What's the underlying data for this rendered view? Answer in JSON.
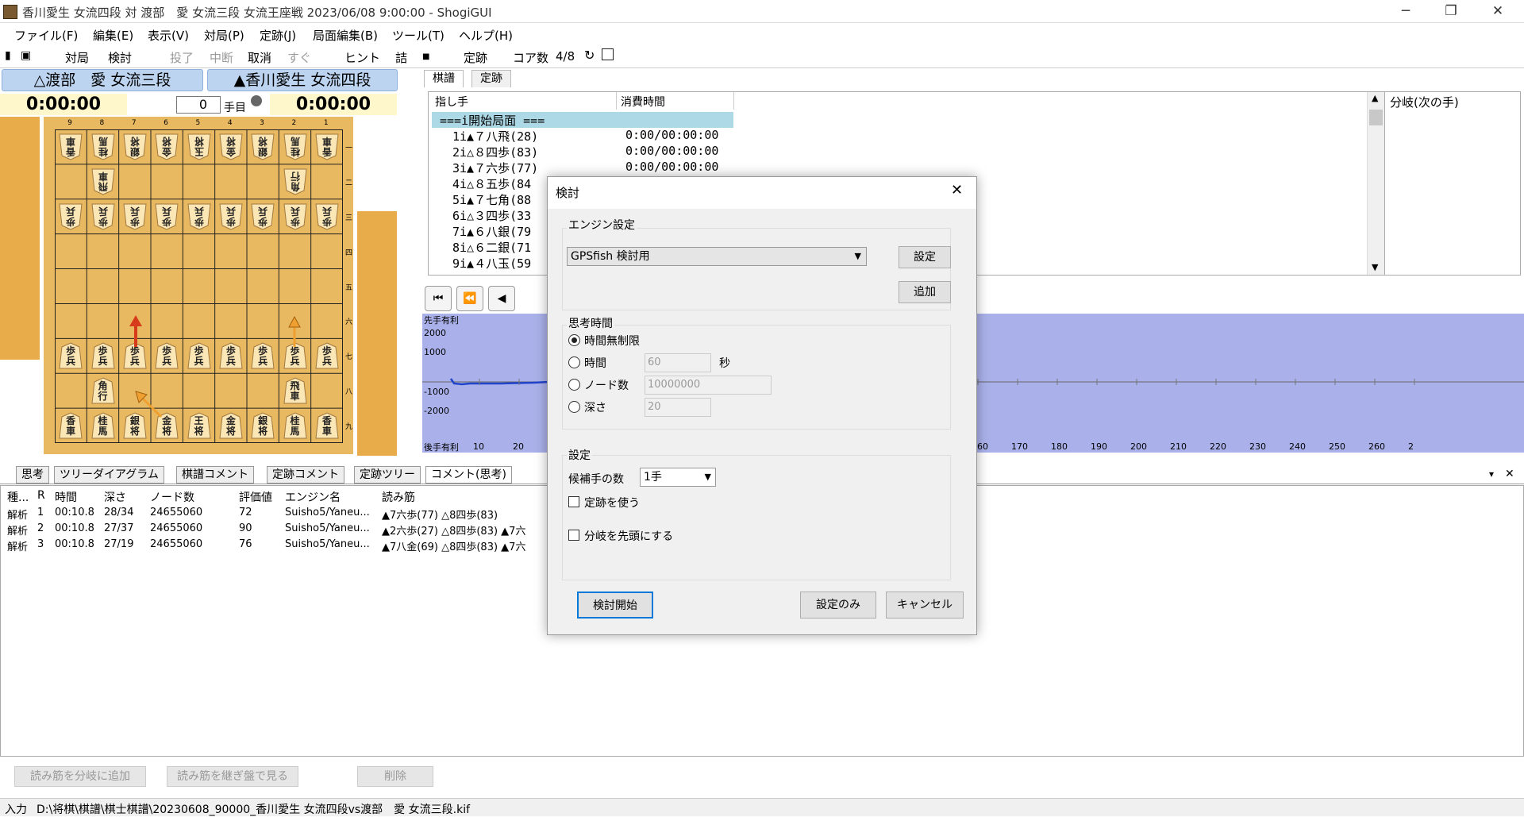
{
  "window": {
    "title": "香川愛生 女流四段 対 渡部　愛 女流三段 女流王座戦 2023/06/08 9:00:00 - ShogiGUI",
    "min": "─",
    "max": "❐",
    "close": "✕"
  },
  "menu": [
    "ファイル(F)",
    "編集(E)",
    "表示(V)",
    "対局(P)",
    "定跡(J)",
    "局面編集(B)",
    "ツール(T)",
    "ヘルプ(H)"
  ],
  "toolbar": {
    "taikyoku": "対局",
    "kentou": "検討",
    "touryou": "投了",
    "chudan": "中断",
    "torikeshi": "取消",
    "sugu": "すぐ",
    "hint": "ヒント",
    "tsume": "詰",
    "joseki": "定跡",
    "core_label": "コア数",
    "core_value": "4/8"
  },
  "players": {
    "gote": "△渡部　愛 女流三段",
    "sente": "▲香川愛生 女流四段",
    "gote_time": "0:00:00",
    "sente_time": "0:00:00",
    "move_no": "0",
    "move_suffix": "手目"
  },
  "board": {
    "files": [
      "9",
      "8",
      "7",
      "6",
      "5",
      "4",
      "3",
      "2",
      "1"
    ],
    "ranks": [
      "一",
      "二",
      "三",
      "四",
      "五",
      "六",
      "七",
      "八",
      "九"
    ],
    "row1": [
      "香\n車",
      "桂\n馬",
      "銀\n将",
      "金\n将",
      "玉\n将",
      "金\n将",
      "銀\n将",
      "桂\n馬",
      "香\n車"
    ],
    "row2": [
      "飛\n車",
      "角\n行"
    ],
    "pawn": "歩\n兵",
    "row8": [
      "角\n行",
      "飛\n車"
    ],
    "row9": [
      "香\n車",
      "桂\n馬",
      "銀\n将",
      "金\n将",
      "王\n将",
      "金\n将",
      "銀\n将",
      "桂\n馬",
      "香\n車"
    ]
  },
  "kifu": {
    "tabs": [
      "棋譜",
      "定跡"
    ],
    "col_move": "指し手",
    "col_time": "消費時間",
    "start": "===i開始局面 ===",
    "rows": [
      {
        "n": "1i",
        "m": "▲７八飛(28)",
        "t": "0:00/00:00:00"
      },
      {
        "n": "2i",
        "m": "△８四歩(83)",
        "t": "0:00/00:00:00"
      },
      {
        "n": "3i",
        "m": "▲７六歩(77)",
        "t": "0:00/00:00:00"
      },
      {
        "n": "4i",
        "m": "△８五歩(84",
        "t": ""
      },
      {
        "n": "5i",
        "m": "▲７七角(88",
        "t": ""
      },
      {
        "n": "6i",
        "m": "△３四歩(33",
        "t": ""
      },
      {
        "n": "7i",
        "m": "▲６八銀(79",
        "t": ""
      },
      {
        "n": "8i",
        "m": "△６二銀(71",
        "t": ""
      },
      {
        "n": "9i",
        "m": "▲４八玉(59",
        "t": ""
      }
    ],
    "branch": "分岐(次の手)"
  },
  "graph": {
    "top_label": "先手有利",
    "bottom_label": "後手有利",
    "yticks": [
      "2000",
      "1000",
      "-1000",
      "-2000"
    ],
    "xticks": [
      "10",
      "20",
      "140",
      "150",
      "160",
      "170",
      "180",
      "190",
      "200",
      "210",
      "220",
      "230",
      "240",
      "250",
      "260",
      "2"
    ]
  },
  "bottom_tabs": [
    "思考",
    "ツリーダイアグラム",
    "棋譜コメント",
    "定跡コメント",
    "定跡ツリー",
    "コメント(思考)"
  ],
  "analysis": {
    "headers": [
      "種...",
      "R",
      "時間",
      "深さ",
      "ノード数",
      "評価値",
      "エンジン名",
      "読み筋"
    ],
    "rows": [
      [
        "解析",
        "1",
        "00:10.8",
        "28/34",
        "24655060",
        "72",
        "Suisho5/Yaneu...",
        "▲7六歩(77) △8四歩(83)"
      ],
      [
        "解析",
        "2",
        "00:10.8",
        "27/37",
        "24655060",
        "90",
        "Suisho5/Yaneu...",
        "▲2六歩(27) △8四歩(83) ▲7六"
      ],
      [
        "解析",
        "3",
        "00:10.8",
        "27/19",
        "24655060",
        "76",
        "Suisho5/Yaneu...",
        "▲7八金(69) △8四歩(83) ▲7六"
      ]
    ],
    "btn_add": "読み筋を分岐に追加",
    "btn_view": "読み筋を継ぎ盤で見る",
    "btn_delete": "削除"
  },
  "status": {
    "label": "入力",
    "path": "D:\\将棋\\棋譜\\棋士棋譜\\20230608_90000_香川愛生 女流四段vs渡部　愛 女流三段.kif"
  },
  "dialog": {
    "title": "検討",
    "engine_group": "エンジン設定",
    "engine": "GPSfish 検討用",
    "btn_settings": "設定",
    "btn_add": "追加",
    "time_group": "思考時間",
    "opt_unlimited": "時間無制限",
    "opt_time": "時間",
    "time_val": "60",
    "sec": "秒",
    "opt_nodes": "ノード数",
    "nodes_val": "10000000",
    "opt_depth": "深さ",
    "depth_val": "20",
    "settings_group": "設定",
    "cand_label": "候補手の数",
    "cand_val": "1手",
    "chk_joseki": "定跡を使う",
    "chk_branch": "分岐を先頭にする",
    "btn_start": "検討開始",
    "btn_only": "設定のみ",
    "btn_cancel": "キャンセル"
  }
}
